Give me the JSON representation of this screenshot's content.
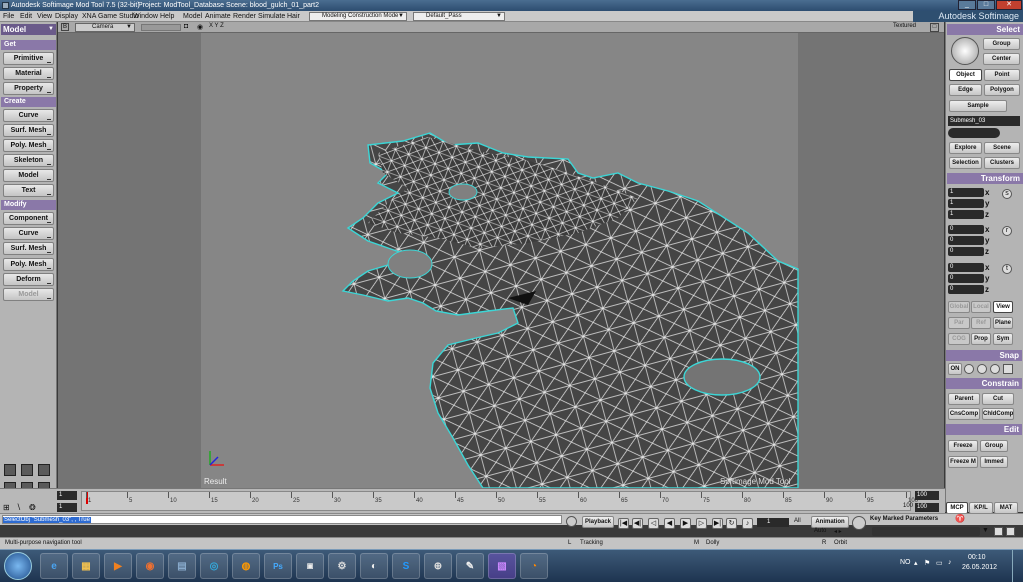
{
  "window": {
    "title": "Autodesk Softimage Mod Tool 7.5 (32-bit)",
    "project": "Project: ModTool_Database",
    "scene": "Scene: blood_gulch_01_part2",
    "brand": "Autodesk Softimage"
  },
  "menubar": {
    "items": [
      "File",
      "Edit",
      "View",
      "Display",
      "XNA Game Studio",
      "Window",
      "Help",
      "Model",
      "Animate",
      "Render",
      "Simulate",
      "Hair"
    ],
    "construction_mode": "Modeling Construction Mode",
    "pass": "Default_Pass"
  },
  "left_panel": {
    "module": "Model",
    "sections": [
      {
        "title": "Get",
        "buttons": [
          "Primitive",
          "Material",
          "Property"
        ]
      },
      {
        "title": "Create",
        "buttons": [
          "Curve",
          "Surf. Mesh",
          "Poly. Mesh",
          "Skeleton",
          "Model",
          "Text"
        ]
      },
      {
        "title": "Modify",
        "buttons": [
          "Component",
          "Curve",
          "Surf. Mesh",
          "Poly. Mesh",
          "Deform",
          "Model"
        ]
      }
    ]
  },
  "viewport": {
    "camera": "Camera",
    "axes_label": "X Y Z",
    "shading": "Textured",
    "result_label": "Result",
    "watermark": "Softimage Mod Tool"
  },
  "right_panel": {
    "select_header": "Select",
    "buttons": {
      "group": "Group",
      "center": "Center",
      "object": "Object",
      "point": "Point",
      "edge": "Edge",
      "polygon": "Polygon",
      "sample": "Sample",
      "explore": "Explore",
      "scene": "Scene",
      "selection": "Selection",
      "clusters": "Clusters"
    },
    "selection_name": "Submesh_03",
    "transform_header": "Transform",
    "scale": [
      "1",
      "1",
      "1"
    ],
    "rotate": [
      "0",
      "0",
      "0"
    ],
    "translate": [
      "0",
      "0",
      "0"
    ],
    "axes": [
      "x",
      "y",
      "z"
    ],
    "ref_modes": [
      "Global",
      "Local",
      "View"
    ],
    "ref_modes2": [
      "Par",
      "Ref",
      "Plane"
    ],
    "ref_modes3": [
      "COG",
      "Prop",
      "Sym"
    ],
    "snap_header": "Snap",
    "snap_on": "ON",
    "constrain_header": "Constrain",
    "constrain_buttons": [
      "Parent",
      "Cut",
      "CnsComp",
      "ChldComp"
    ],
    "edit_header": "Edit",
    "edit_buttons": [
      "Freeze",
      "Group",
      "Freeze M",
      "Immed"
    ],
    "bottom_tabs": [
      "MCP",
      "KP/L",
      "MAT"
    ]
  },
  "timeline": {
    "start": "1",
    "current": "1",
    "end": "100",
    "end2": "100",
    "ticks": [
      "1",
      "5",
      "10",
      "15",
      "20",
      "25",
      "30",
      "35",
      "40",
      "45",
      "50",
      "55",
      "60",
      "65",
      "70",
      "75",
      "80",
      "85",
      "90",
      "95",
      "100"
    ]
  },
  "command_line": {
    "text": "SelectObj \"Submesh_03\", , True"
  },
  "playback": {
    "label": "Playback",
    "frame": "1",
    "all": "All",
    "animation": "Animation",
    "auto": "Auto",
    "key_marked": "Key Marked Parameters"
  },
  "status": {
    "hint": "Multi-purpose navigation tool",
    "tracking": "Tracking",
    "dolly": "Dolly",
    "orbit": "Orbit"
  },
  "taskbar": {
    "lang": "NO",
    "time": "00:10",
    "date": "26.05.2012"
  }
}
